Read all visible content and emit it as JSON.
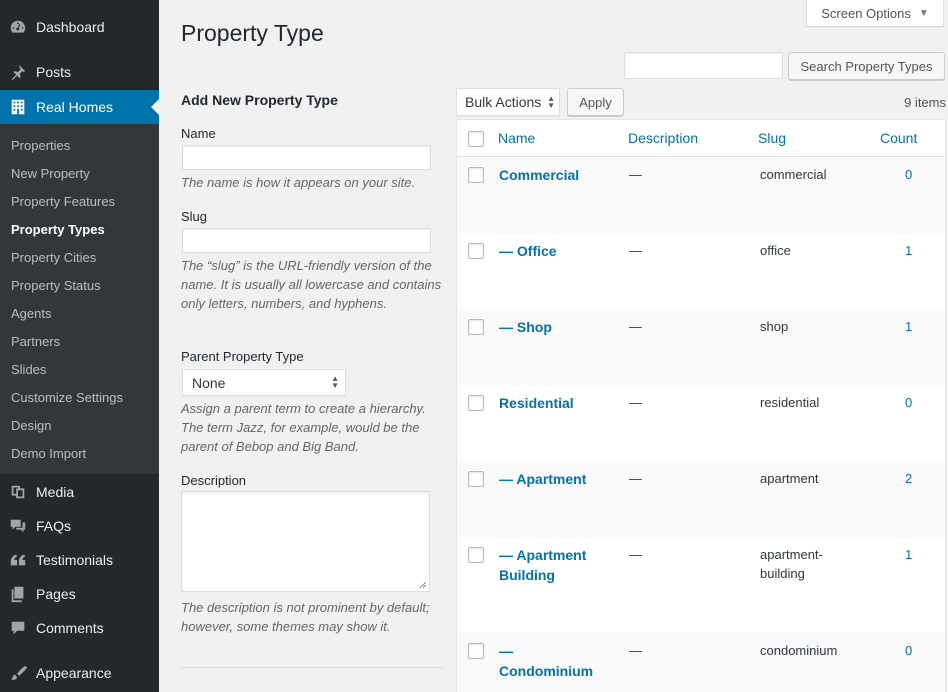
{
  "sidebar": {
    "top_items": [
      {
        "label": "Dashboard",
        "icon": "dashboard-icon"
      },
      {
        "label": "Posts",
        "icon": "pin-icon"
      },
      {
        "label": "Real Homes",
        "icon": "building-icon"
      },
      {
        "label": "Media",
        "icon": "media-icon"
      },
      {
        "label": "FAQs",
        "icon": "faq-icon"
      },
      {
        "label": "Testimonials",
        "icon": "quote-icon"
      },
      {
        "label": "Pages",
        "icon": "pages-icon"
      },
      {
        "label": "Comments",
        "icon": "comments-icon"
      },
      {
        "label": "Appearance",
        "icon": "brush-icon"
      }
    ],
    "submenu": [
      "Properties",
      "New Property",
      "Property Features",
      "Property Types",
      "Property Cities",
      "Property Status",
      "Agents",
      "Partners",
      "Slides",
      "Customize Settings",
      "Design",
      "Demo Import"
    ],
    "active_color": "#0073aa"
  },
  "screen_options": {
    "label": "Screen Options",
    "arrow": "▼"
  },
  "page_title": "Property Type",
  "search": {
    "value": "",
    "button": "Search Property Types"
  },
  "form": {
    "heading": "Add New Property Type",
    "name_label": "Name",
    "name_value": "",
    "name_help": "The name is how it appears on your site.",
    "slug_label": "Slug",
    "slug_value": "",
    "slug_help": "The “slug” is the URL-friendly version of the name. It is usually all lowercase and contains only letters, numbers, and hyphens.",
    "parent_label": "Parent Property Type",
    "parent_value": "None",
    "parent_help": "Assign a parent term to create a hierarchy. The term Jazz, for example, would be the parent of Bebop and Big Band.",
    "description_label": "Description",
    "description_value": "",
    "description_help": "The description is not prominent by default; however, some themes may show it."
  },
  "bulk": {
    "value": "Bulk Actions",
    "apply": "Apply",
    "items_count": "9 items"
  },
  "table": {
    "columns": [
      "Name",
      "Description",
      "Slug",
      "Count"
    ],
    "rows": [
      {
        "name": "Commercial",
        "description": "—",
        "slug": "commercial",
        "count": "0"
      },
      {
        "name": "— Office",
        "description": "—",
        "slug": "office",
        "count": "1"
      },
      {
        "name": "— Shop",
        "description": "—",
        "slug": "shop",
        "count": "1"
      },
      {
        "name": "Residential",
        "description": "—",
        "slug": "residential",
        "count": "0"
      },
      {
        "name": "— Apartment",
        "description": "—",
        "slug": "apartment",
        "count": "2"
      },
      {
        "name": "— Apartment Building",
        "description": "—",
        "slug": "apartment-building",
        "count": "1"
      },
      {
        "name": "— Condominium",
        "description": "—",
        "slug": "condominium",
        "count": "0"
      }
    ]
  }
}
